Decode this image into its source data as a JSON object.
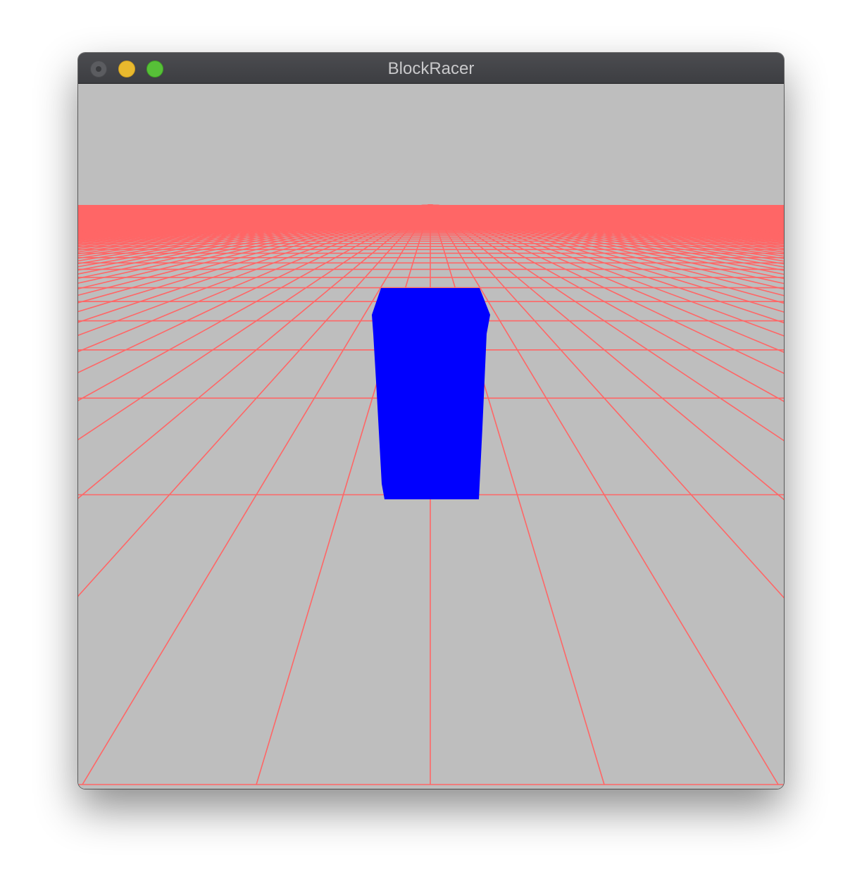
{
  "window": {
    "title": "BlockRacer"
  },
  "controls": {
    "close": "close-button",
    "minimize": "minimize-button",
    "zoom": "zoom-button"
  },
  "colors": {
    "sky": "#bebebe",
    "ground": "#bebebe",
    "grid": "#ff6666",
    "horizon_band": "#ff6666",
    "player_block": "#0000ff",
    "titlebar": "#434448"
  }
}
